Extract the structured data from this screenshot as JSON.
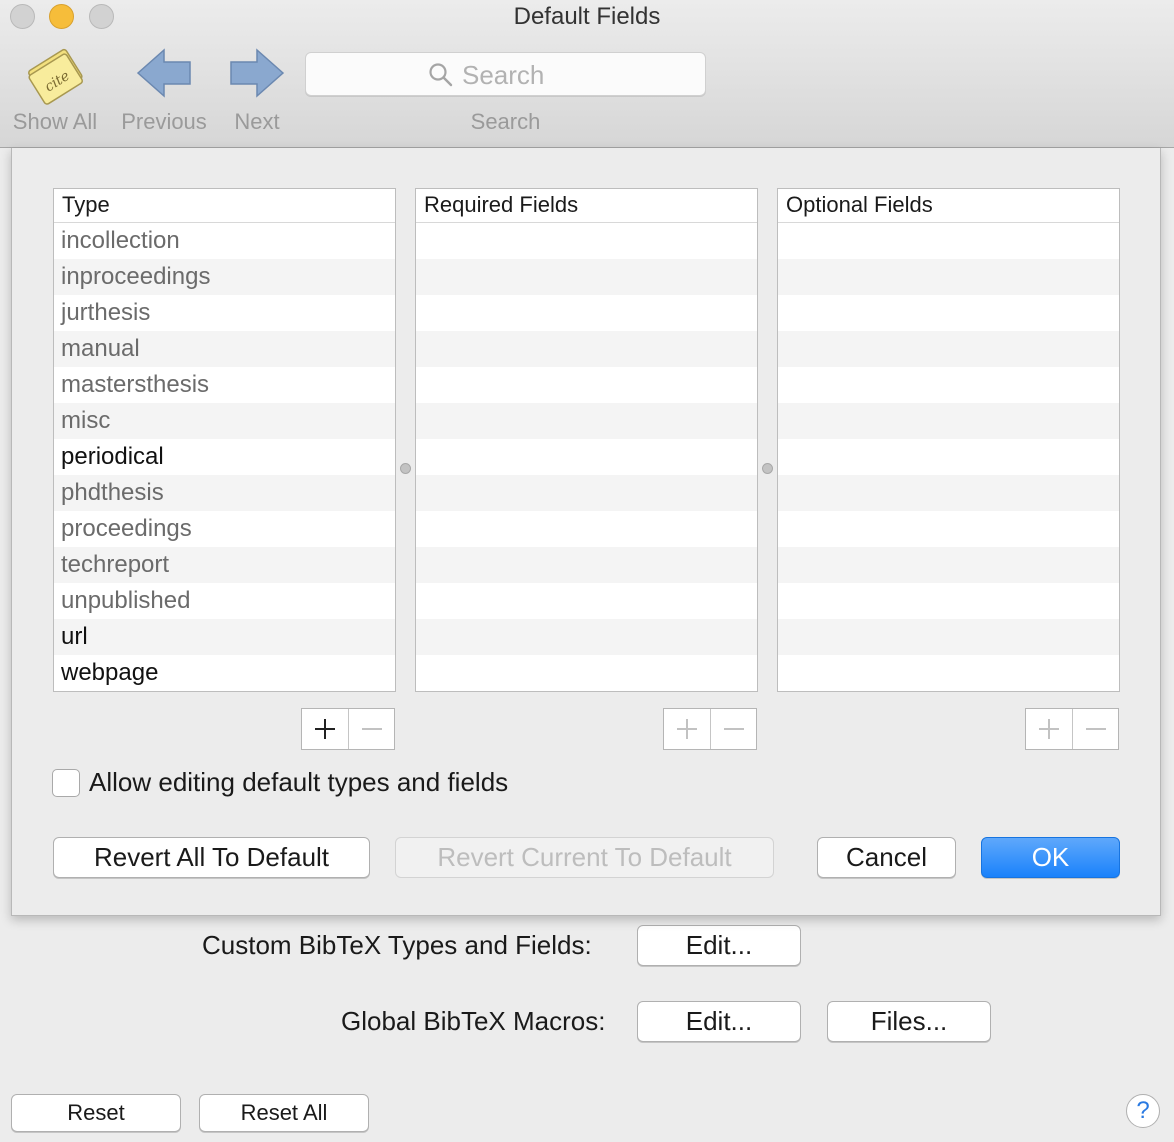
{
  "window": {
    "title": "Default Fields"
  },
  "toolbar": {
    "show_all_label": "Show All",
    "app_icon_text": "cite",
    "previous_label": "Previous",
    "next_label": "Next",
    "search_placeholder": "Search",
    "search_label": "Search"
  },
  "tables": {
    "type": {
      "header": "Type",
      "rows": [
        {
          "label": "incollection",
          "style": "dim"
        },
        {
          "label": "inproceedings",
          "style": "dim"
        },
        {
          "label": "jurthesis",
          "style": "dim"
        },
        {
          "label": "manual",
          "style": "dim"
        },
        {
          "label": "mastersthesis",
          "style": "dim"
        },
        {
          "label": "misc",
          "style": "dim"
        },
        {
          "label": "periodical",
          "style": "strong"
        },
        {
          "label": "phdthesis",
          "style": "dim"
        },
        {
          "label": "proceedings",
          "style": "dim"
        },
        {
          "label": "techreport",
          "style": "dim"
        },
        {
          "label": "unpublished",
          "style": "dim"
        },
        {
          "label": "url",
          "style": "strong"
        },
        {
          "label": "webpage",
          "style": "strong"
        }
      ]
    },
    "required": {
      "header": "Required Fields",
      "rows": []
    },
    "optional": {
      "header": "Optional Fields",
      "rows": []
    }
  },
  "sheet": {
    "allow_editing_label": "Allow editing default types and fields",
    "allow_editing_checked": false,
    "revert_all_label": "Revert All To Default",
    "revert_current_label": "Revert Current To Default",
    "cancel_label": "Cancel",
    "ok_label": "OK"
  },
  "prefs": {
    "custom_types_label": "Custom BibTeX Types and Fields:",
    "custom_types_edit_label": "Edit...",
    "global_macros_label": "Global BibTeX Macros:",
    "global_macros_edit_label": "Edit...",
    "global_macros_files_label": "Files...",
    "reset_label": "Reset",
    "reset_all_label": "Reset All",
    "help_label": "?"
  },
  "colors": {
    "accent": "#1a82fb",
    "minimize": "#f6bd3a"
  }
}
